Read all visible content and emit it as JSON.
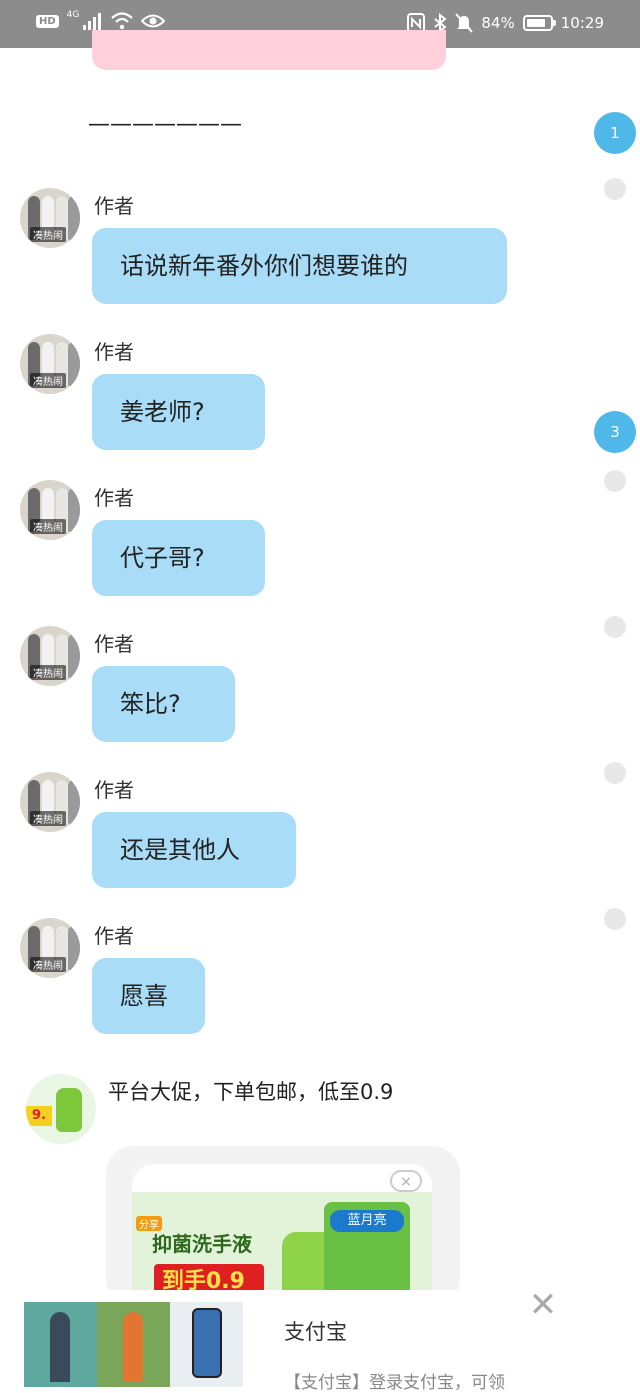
{
  "status_bar": {
    "hd": "HD",
    "network": "4G",
    "battery_text": "84%",
    "battery_level": 0.84,
    "time": "10:29",
    "icons": [
      "hd-icon",
      "signal-icon",
      "wifi-icon",
      "eye-icon",
      "nfc-icon",
      "bluetooth-icon",
      "mute-icon",
      "battery-icon"
    ]
  },
  "separator": "———————",
  "side_badges": [
    "1",
    "3"
  ],
  "messages": [
    {
      "author": "作者",
      "text": "话说新年番外你们想要谁的"
    },
    {
      "author": "作者",
      "text": "姜老师?"
    },
    {
      "author": "作者",
      "text": "代子哥?"
    },
    {
      "author": "作者",
      "text": "笨比?"
    },
    {
      "author": "作者",
      "text": "还是其他人"
    },
    {
      "author": "作者",
      "text": "愿喜"
    }
  ],
  "avatar_caption": "凑热闹",
  "ad": {
    "text": "平台大促，下单包邮，低至0.9",
    "avatar_tag": "9.",
    "poster_title": "抑菌洗手液",
    "poster_price": "到手0.9",
    "poster_brand": "蓝月亮",
    "poster_badge": "分享",
    "close_label": "×"
  },
  "banner": {
    "title": "支付宝",
    "description": "【支付宝】登录支付宝，可领",
    "close_label": "✕"
  },
  "colors": {
    "bubble": "#a9dcf7",
    "badge": "#4fb8e8",
    "status_bar": "#8c8c8c",
    "pink": "#ffd0dc"
  }
}
